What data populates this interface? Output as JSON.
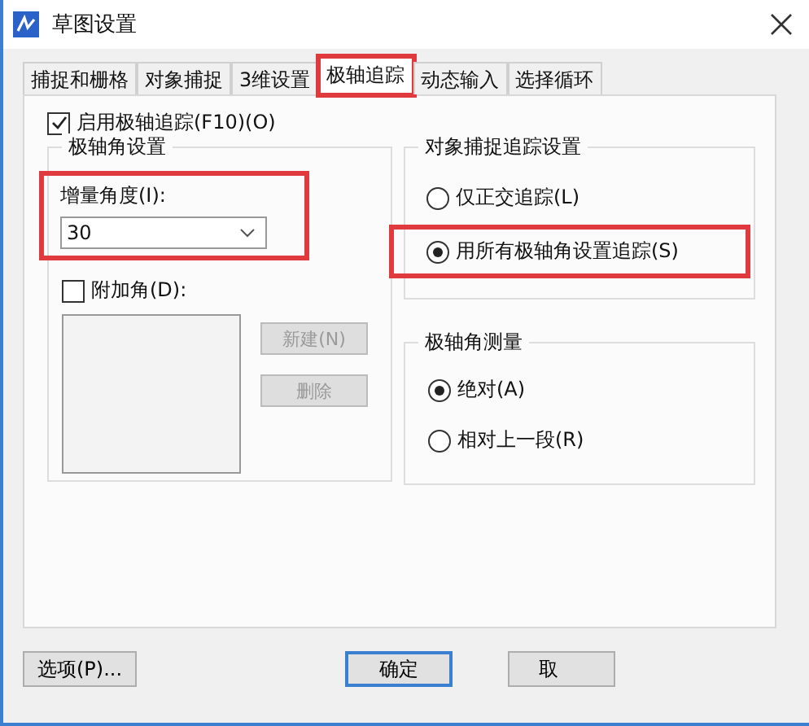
{
  "window": {
    "title": "草图设置"
  },
  "tabs": [
    {
      "label": "捕捉和栅格",
      "selected": false,
      "highlighted": false
    },
    {
      "label": "对象捕捉",
      "selected": false,
      "highlighted": false
    },
    {
      "label": "3维设置",
      "selected": false,
      "highlighted": false
    },
    {
      "label": "极轴追踪",
      "selected": true,
      "highlighted": true
    },
    {
      "label": "动态输入",
      "selected": false,
      "highlighted": false
    },
    {
      "label": "选择循环",
      "selected": false,
      "highlighted": false
    }
  ],
  "enable_checkbox": {
    "label": "启用极轴追踪(F10)(O)",
    "checked": true
  },
  "polar_angle_settings": {
    "title": "极轴角设置",
    "increment": {
      "label": "增量角度(I):",
      "value": "30",
      "highlighted": true
    },
    "additional": {
      "label": "附加角(D):",
      "checked": false
    },
    "buttons": [
      {
        "label": "新建(N)",
        "disabled": true
      },
      {
        "label": "删除",
        "disabled": true
      }
    ]
  },
  "object_snap_tracking": {
    "title": "对象捕捉追踪设置",
    "options": [
      {
        "label": "仅正交追踪(L)",
        "selected": false,
        "highlighted": false
      },
      {
        "label": "用所有极轴角设置追踪(S)",
        "selected": true,
        "highlighted": true
      }
    ]
  },
  "polar_measurement": {
    "title": "极轴角测量",
    "options": [
      {
        "label": "绝对(A)",
        "selected": true
      },
      {
        "label": "相对上一段(R)",
        "selected": false
      }
    ]
  },
  "footer": {
    "options_button": "选项(P)...",
    "ok_button": "确定",
    "cancel_button": "取"
  }
}
